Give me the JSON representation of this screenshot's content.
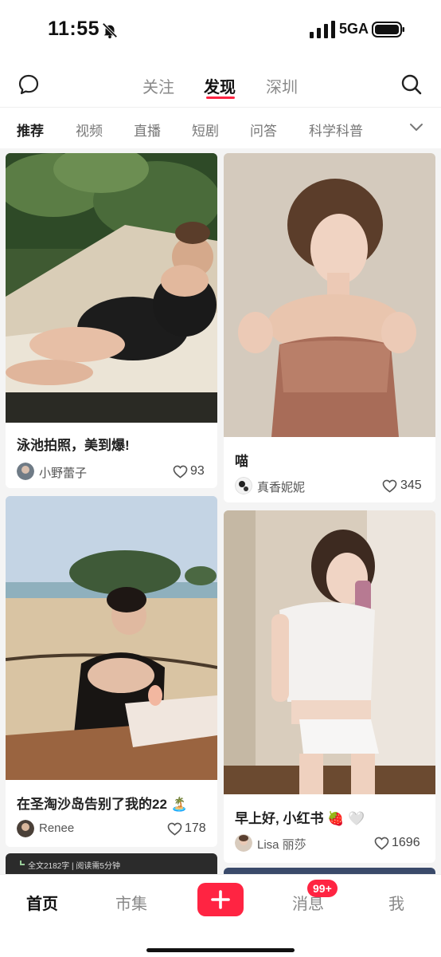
{
  "status_bar": {
    "time": "11:55",
    "network": "5GA",
    "icons": [
      "bell-mute-icon",
      "signal-icon",
      "battery-icon"
    ]
  },
  "top_nav": {
    "tabs": [
      {
        "label": "关注",
        "active": false
      },
      {
        "label": "发现",
        "active": true
      },
      {
        "label": "深圳",
        "active": false
      }
    ],
    "icons": [
      "chat-icon",
      "search-icon"
    ],
    "accent": "#ff2442"
  },
  "categories": [
    {
      "label": "推荐",
      "active": true
    },
    {
      "label": "视频",
      "active": false
    },
    {
      "label": "直播",
      "active": false
    },
    {
      "label": "短剧",
      "active": false
    },
    {
      "label": "问答",
      "active": false
    },
    {
      "label": "科学科普",
      "active": false
    }
  ],
  "feed": [
    {
      "title": "泳池拍照，美到爆!",
      "author": "小野蕾子",
      "likes": "93"
    },
    {
      "title": "喵",
      "author": "真香妮妮",
      "likes": "345"
    },
    {
      "title": "在圣淘沙岛告别了我的22 🏝️",
      "author": "Renee",
      "likes": "178"
    },
    {
      "title": "早上好, 小红书 🍓 🤍",
      "author": "Lisa 丽莎",
      "likes": "1696"
    }
  ],
  "partial_card": {
    "text": "全文2182字 | 阅读需5分钟"
  },
  "bottom_nav": {
    "items": [
      {
        "label": "首页",
        "active": true
      },
      {
        "label": "市集",
        "active": false
      },
      {
        "label": "消息",
        "active": false
      },
      {
        "label": "我",
        "active": false
      }
    ],
    "badge": "99+",
    "plus_icon": "plus-icon"
  }
}
